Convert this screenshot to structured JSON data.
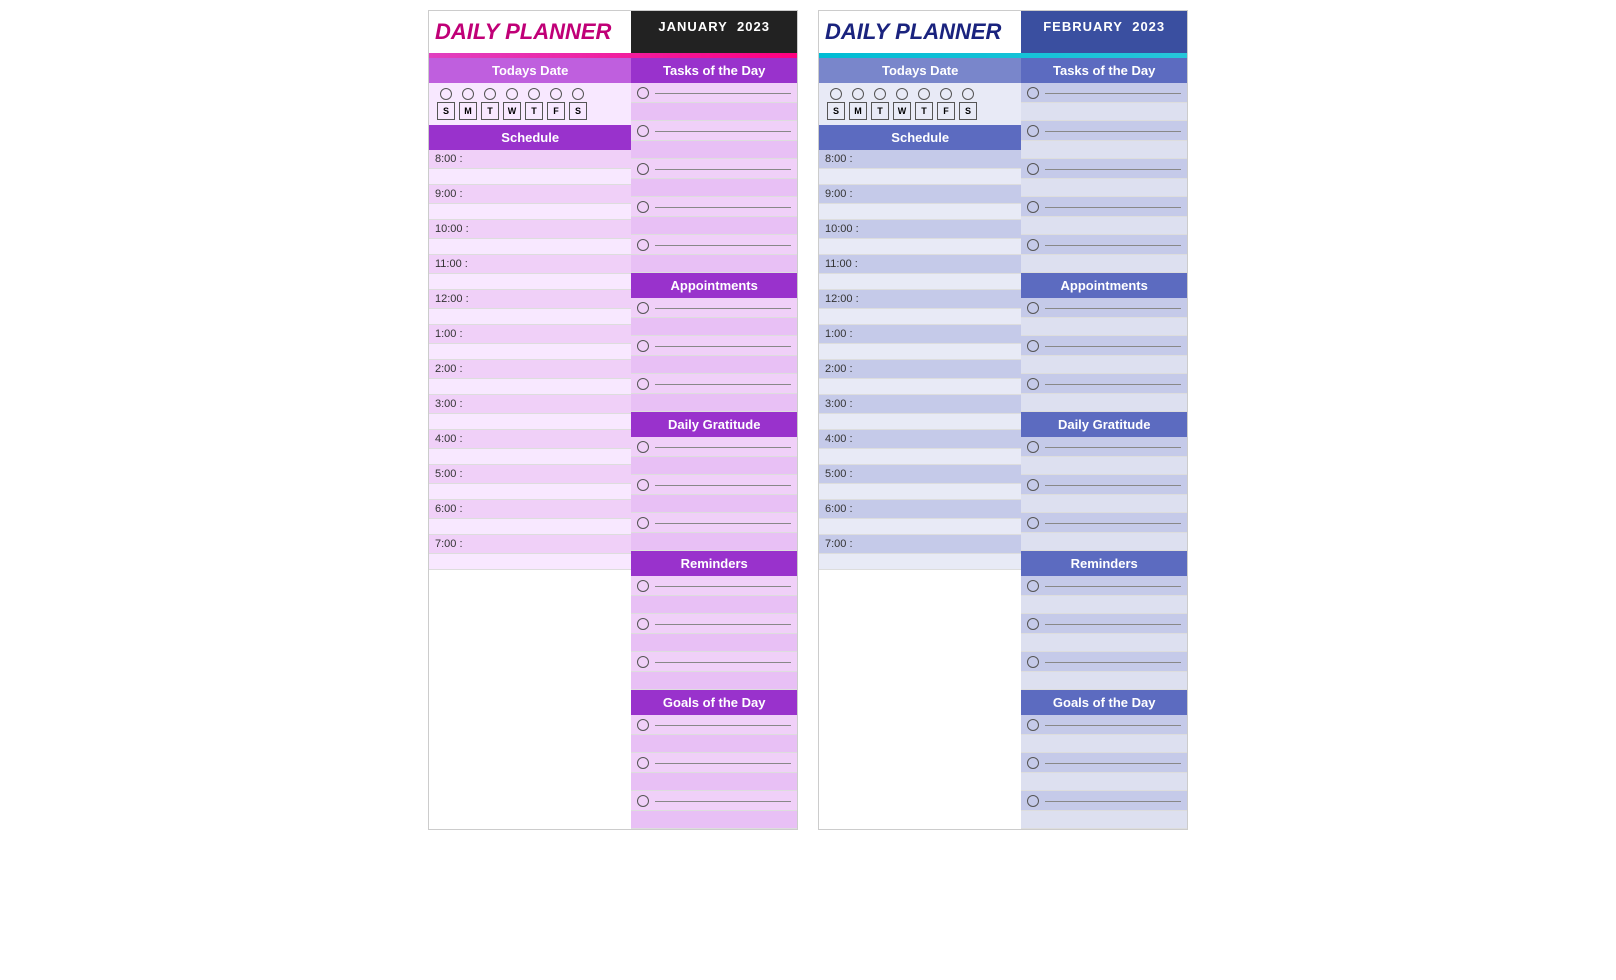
{
  "january": {
    "title": "DAILY PLANNER",
    "month": "JANUARY",
    "year": "2023",
    "todays_date_label": "Todays Date",
    "tasks_label": "Tasks of the Day",
    "schedule_label": "Schedule",
    "appointments_label": "Appointments",
    "daily_gratitude_label": "Daily Gratitude",
    "reminders_label": "Reminders",
    "goals_label": "Goals of the Day",
    "days": [
      "S",
      "M",
      "T",
      "W",
      "T",
      "F",
      "S"
    ],
    "times": [
      "8:00 :",
      "9:00 :",
      "10:00 :",
      "11:00 :",
      "12:00 :",
      "1:00 :",
      "2:00 :",
      "3:00 :",
      "4:00 :",
      "5:00 :",
      "6:00 :",
      "7:00 :"
    ]
  },
  "february": {
    "title": "DAILY PLANNER",
    "month": "FEBRUARY",
    "year": "2023",
    "todays_date_label": "Todays Date",
    "tasks_label": "Tasks of the Day",
    "schedule_label": "Schedule",
    "appointments_label": "Appointments",
    "daily_gratitude_label": "Daily Gratitude",
    "reminders_label": "Reminders",
    "goals_label": "Goals of the Day",
    "days": [
      "S",
      "M",
      "T",
      "W",
      "T",
      "F",
      "S"
    ],
    "times": [
      "8:00 :",
      "9:00 :",
      "10:00 :",
      "11:00 :",
      "12:00 :",
      "1:00 :",
      "2:00 :",
      "3:00 :",
      "4:00 :",
      "5:00 :",
      "6:00 :",
      "7:00 :"
    ]
  }
}
